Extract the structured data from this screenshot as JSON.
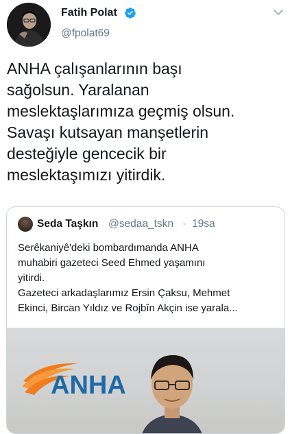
{
  "header": {
    "display_name": "Fatih Polat",
    "handle": "@fpolat69"
  },
  "tweet": {
    "text": "ANHA çalışanlarının başı\nsağolsun. Yaralanan\nmeslektaşlarımıza geçmiş olsun.\nSavaşı kutsayan manşetlerin\ndesteğiyle gencecik bir\nmeslektaşımızı yitirdik."
  },
  "quote": {
    "name": "Seda Taşkın",
    "handle": "@sedaa_tskn",
    "separator": "·",
    "time": "19sa",
    "text": "Serêkaniyê'deki bombardımanda ANHA\nmuhabiri gazeteci Seed Ehmed yaşamını\nyitirdi.\nGazeteci arkadaşlarımız Ersin Çaksu, Mehmet\nEkinci, Bircan Yıldız ve Rojbîn Akçin ise yarala...",
    "media_logo_text": "ANHA"
  },
  "colors": {
    "accent": "#1da1f2",
    "secondary_text": "#657786",
    "border": "#ccd6dd",
    "logo_orange": "#f07c1f",
    "logo_blue": "#1e6aa8"
  },
  "icons": {
    "verified": "verified-badge-icon",
    "menu": "chevron-down-icon"
  }
}
